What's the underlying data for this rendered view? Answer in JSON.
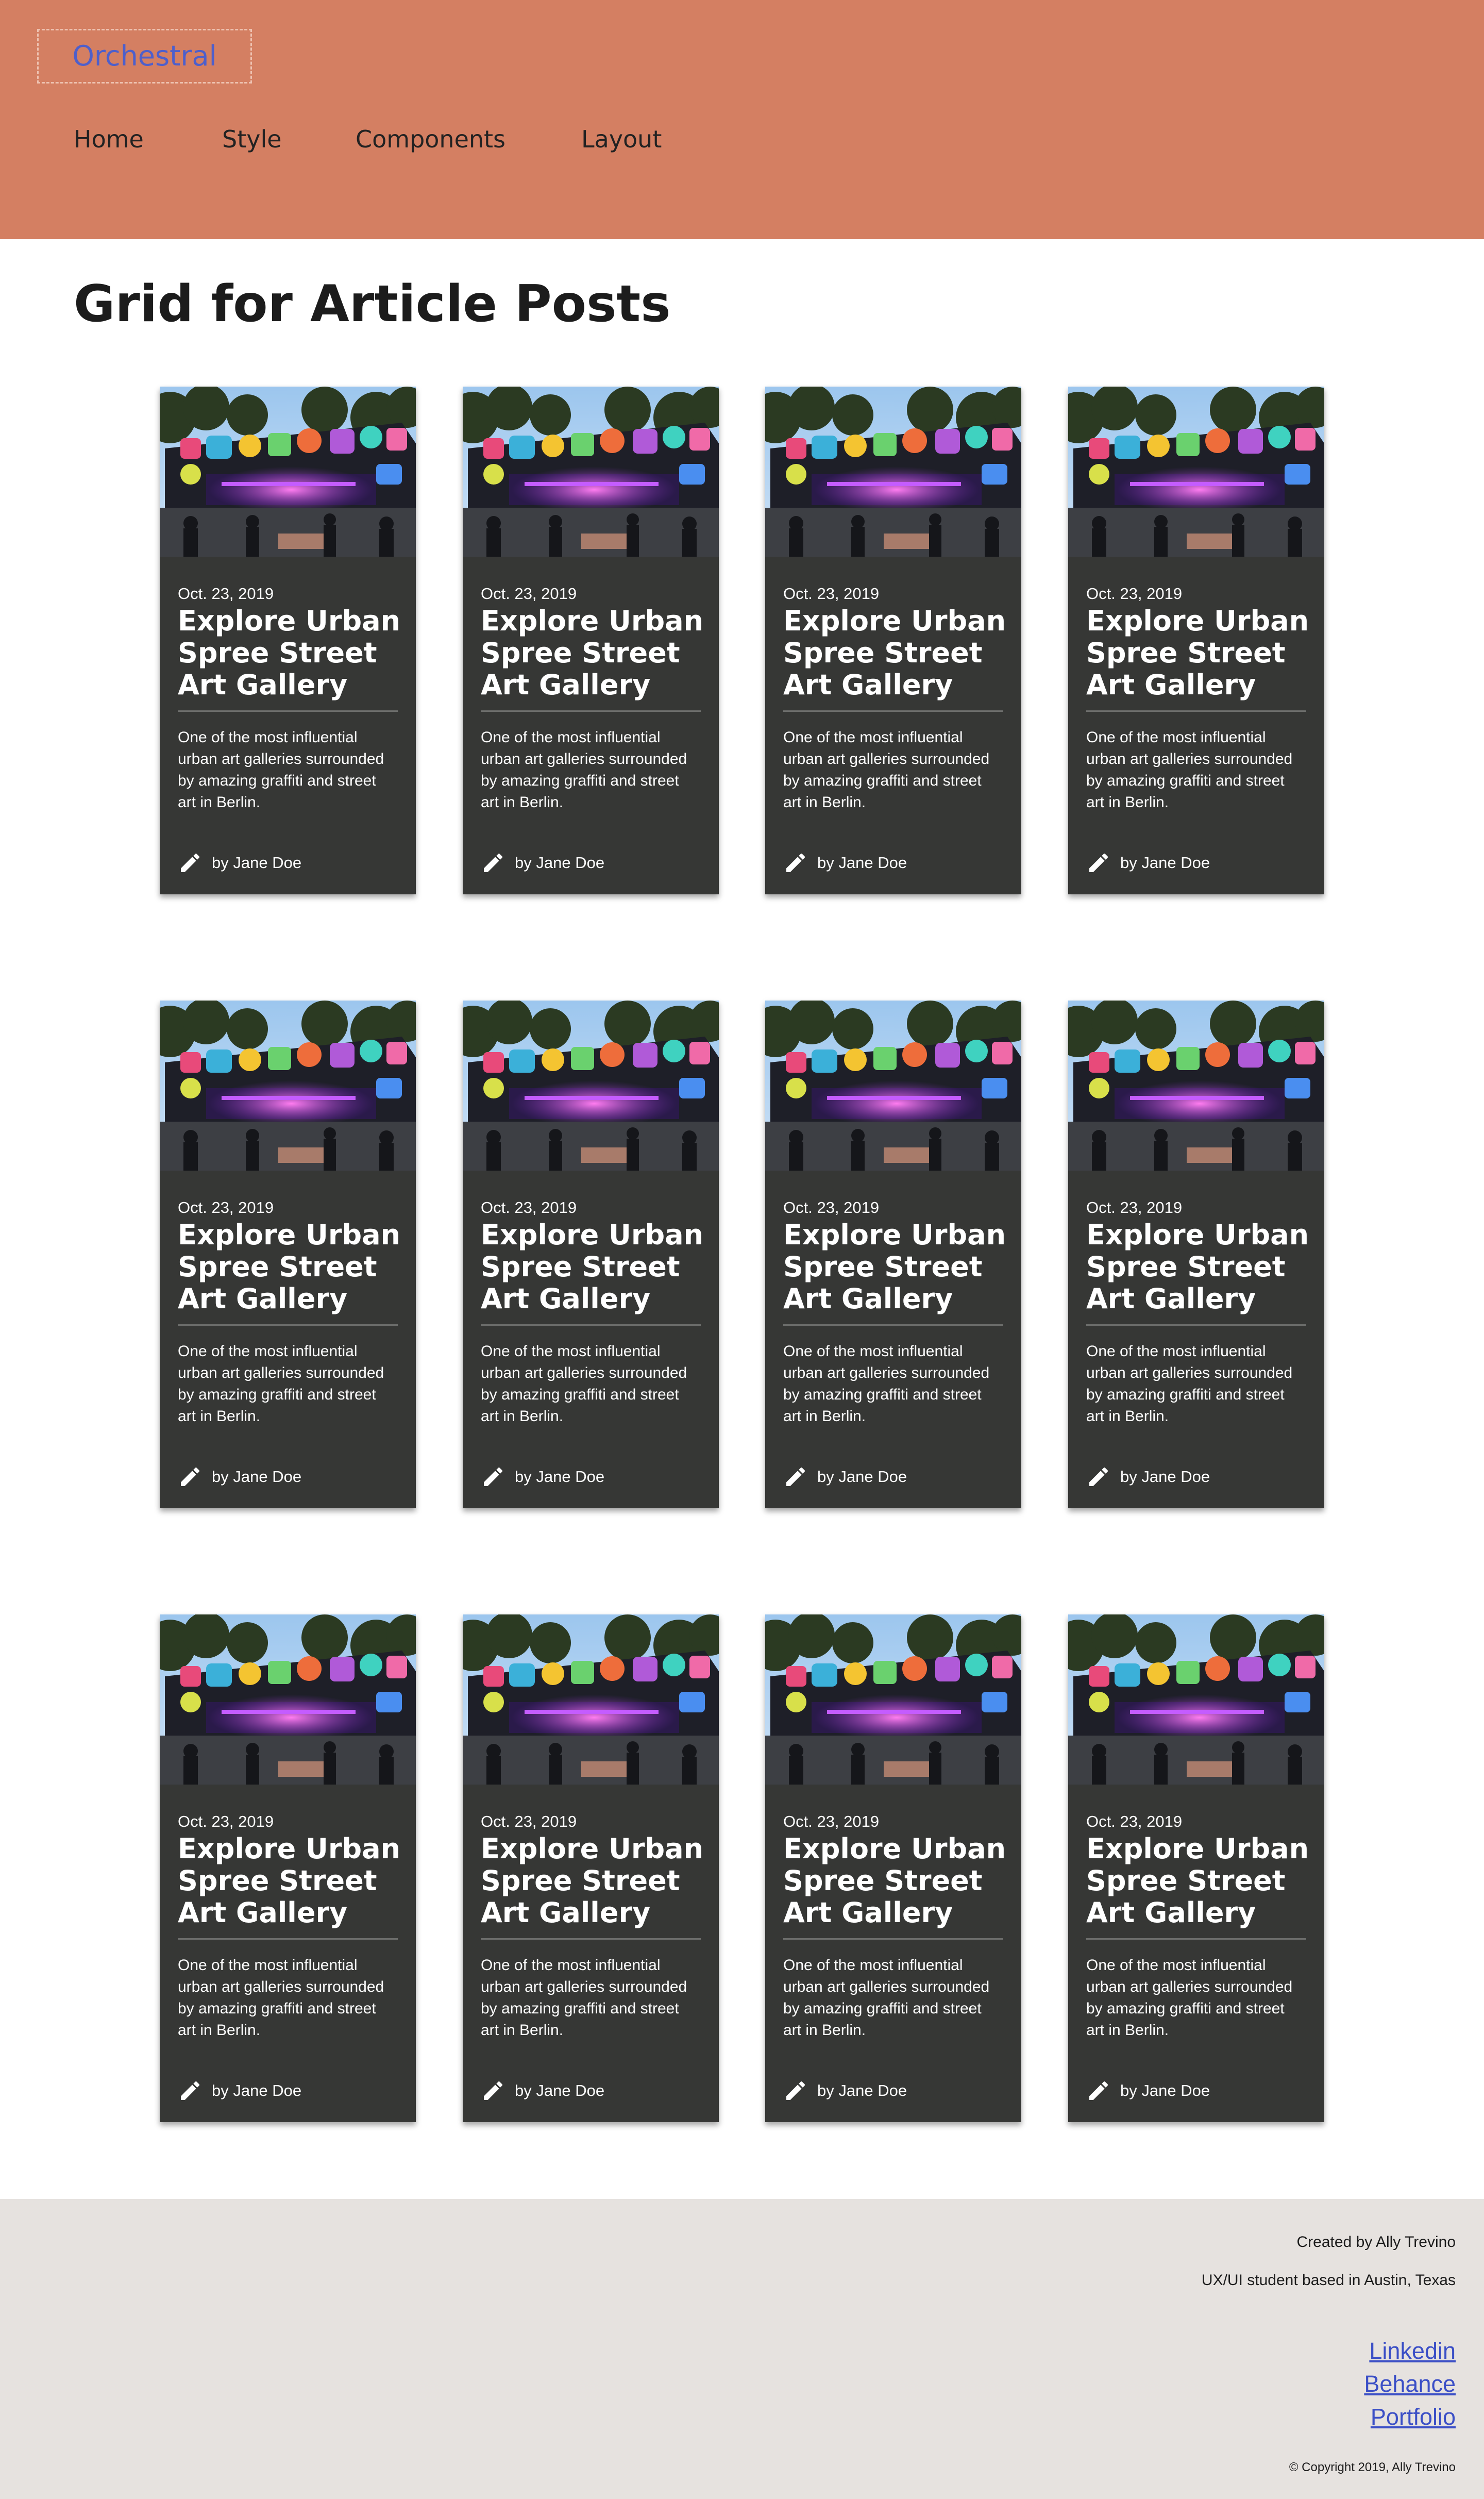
{
  "header": {
    "logo": "Orchestral",
    "nav": [
      "Home",
      "Style",
      "Components",
      "Layout"
    ]
  },
  "page": {
    "title": "Grid for Article Posts"
  },
  "card_template": {
    "image_alt": "Urban Spree gallery building covered in colorful graffiti",
    "date": "Oct. 23, 2019",
    "title": "Explore Urban Spree Street Art Gallery",
    "excerpt": "One of the most influential urban art galleries surrounded by amazing graffiti and street art in Berlin.",
    "author": "by Jane Doe",
    "author_icon": "pencil-icon"
  },
  "cards": [
    {
      "date": "Oct. 23, 2019",
      "title": "Explore Urban Spree Street Art Gallery",
      "excerpt": "One of the most influential urban art galleries surrounded by amazing graffiti and street art in Berlin.",
      "author": "by Jane Doe"
    },
    {
      "date": "Oct. 23, 2019",
      "title": "Explore Urban Spree Street Art Gallery",
      "excerpt": "One of the most influential urban art galleries surrounded by amazing graffiti and street art in Berlin.",
      "author": "by Jane Doe"
    },
    {
      "date": "Oct. 23, 2019",
      "title": "Explore Urban Spree Street Art Gallery",
      "excerpt": "One of the most influential urban art galleries surrounded by amazing graffiti and street art in Berlin.",
      "author": "by Jane Doe"
    },
    {
      "date": "Oct. 23, 2019",
      "title": "Explore Urban Spree Street Art Gallery",
      "excerpt": "One of the most influential urban art galleries surrounded by amazing graffiti and street art in Berlin.",
      "author": "by Jane Doe"
    },
    {
      "date": "Oct. 23, 2019",
      "title": "Explore Urban Spree Street Art Gallery",
      "excerpt": "One of the most influential urban art galleries surrounded by amazing graffiti and street art in Berlin.",
      "author": "by Jane Doe"
    },
    {
      "date": "Oct. 23, 2019",
      "title": "Explore Urban Spree Street Art Gallery",
      "excerpt": "One of the most influential urban art galleries surrounded by amazing graffiti and street art in Berlin.",
      "author": "by Jane Doe"
    },
    {
      "date": "Oct. 23, 2019",
      "title": "Explore Urban Spree Street Art Gallery",
      "excerpt": "One of the most influential urban art galleries surrounded by amazing graffiti and street art in Berlin.",
      "author": "by Jane Doe"
    },
    {
      "date": "Oct. 23, 2019",
      "title": "Explore Urban Spree Street Art Gallery",
      "excerpt": "One of the most influential urban art galleries surrounded by amazing graffiti and street art in Berlin.",
      "author": "by Jane Doe"
    },
    {
      "date": "Oct. 23, 2019",
      "title": "Explore Urban Spree Street Art Gallery",
      "excerpt": "One of the most influential urban art galleries surrounded by amazing graffiti and street art in Berlin.",
      "author": "by Jane Doe"
    },
    {
      "date": "Oct. 23, 2019",
      "title": "Explore Urban Spree Street Art Gallery",
      "excerpt": "One of the most influential urban art galleries surrounded by amazing graffiti and street art in Berlin.",
      "author": "by Jane Doe"
    },
    {
      "date": "Oct. 23, 2019",
      "title": "Explore Urban Spree Street Art Gallery",
      "excerpt": "One of the most influential urban art galleries surrounded by amazing graffiti and street art in Berlin.",
      "author": "by Jane Doe"
    },
    {
      "date": "Oct. 23, 2019",
      "title": "Explore Urban Spree Street Art Gallery",
      "excerpt": "One of the most influential urban art galleries surrounded by amazing graffiti and street art in Berlin.",
      "author": "by Jane Doe"
    }
  ],
  "footer": {
    "created_by": "Created by Ally Trevino",
    "tagline": "UX/UI student based in Austin, Texas",
    "links": [
      "Linkedin",
      "Behance",
      "Portfolio"
    ],
    "copyright": "© Copyright 2019, Ally Trevino"
  },
  "colors": {
    "header_bg": "#D47F62",
    "logo_text": "#4e5fcb",
    "card_bg": "#363735",
    "footer_bg": "#E6E2DF",
    "link": "#3b4fc6"
  }
}
